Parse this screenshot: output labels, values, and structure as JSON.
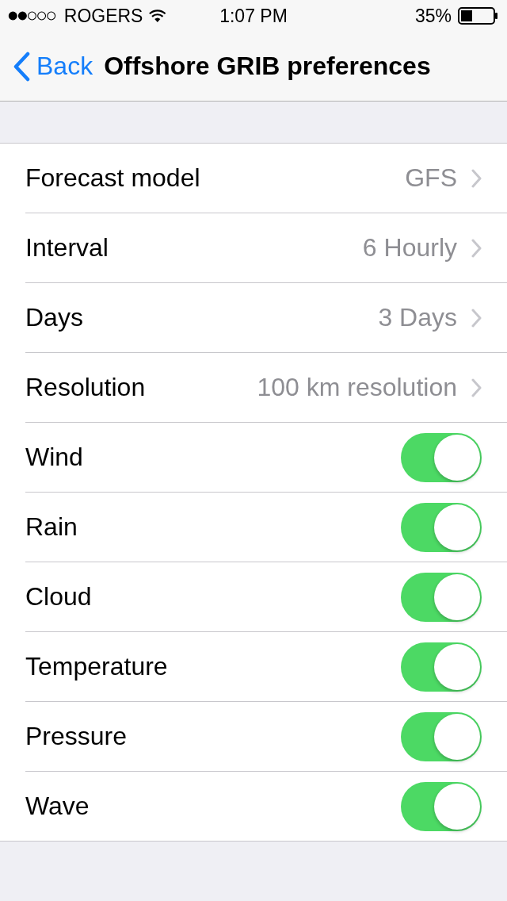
{
  "status_bar": {
    "carrier": "ROGERS",
    "time": "1:07 PM",
    "battery": "35%"
  },
  "nav": {
    "back": "Back",
    "title": "Offshore GRIB preferences"
  },
  "rows": [
    {
      "kind": "value",
      "label": "Forecast model",
      "value": "GFS"
    },
    {
      "kind": "value",
      "label": "Interval",
      "value": "6 Hourly"
    },
    {
      "kind": "value",
      "label": "Days",
      "value": "3 Days"
    },
    {
      "kind": "value",
      "label": "Resolution",
      "value": "100 km resolution"
    },
    {
      "kind": "toggle",
      "label": "Wind",
      "on": true
    },
    {
      "kind": "toggle",
      "label": "Rain",
      "on": true
    },
    {
      "kind": "toggle",
      "label": "Cloud",
      "on": true
    },
    {
      "kind": "toggle",
      "label": "Temperature",
      "on": true
    },
    {
      "kind": "toggle",
      "label": "Pressure",
      "on": true
    },
    {
      "kind": "toggle",
      "label": "Wave",
      "on": true
    }
  ]
}
